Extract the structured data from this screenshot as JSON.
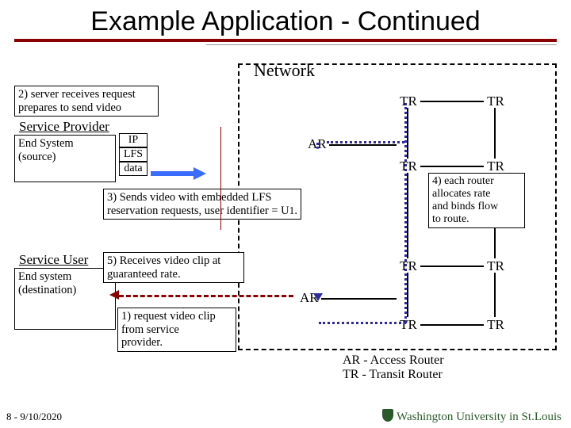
{
  "title": "Example Application - Continued",
  "network_label": "Network",
  "step2": "2) server receives request\n    prepares to send video",
  "service_provider_label": "Service Provider",
  "end_system_source": "End System\n(source)",
  "stack": {
    "ip": "IP",
    "lfs": "LFS",
    "data": "data"
  },
  "step3": "3) Sends video with embedded LFS reservation requests, user identifier = U",
  "step3_subscript": "1",
  "service_user_label": "Service User",
  "end_system_dest": "End system\n(destination)",
  "step5": "5) Receives video clip at\n    guaranteed rate.",
  "step1": "1) request video clip\n    from service\n    provider.",
  "step4": "4) each router\n    allocates rate\n    and binds flow\n    to route.",
  "ar_label": "AR",
  "tr_label": "TR",
  "legend": "AR - Access Router\nTR - Transit Router",
  "footer": "8 - 9/10/2020",
  "wustl": "Washington University in St.Louis"
}
